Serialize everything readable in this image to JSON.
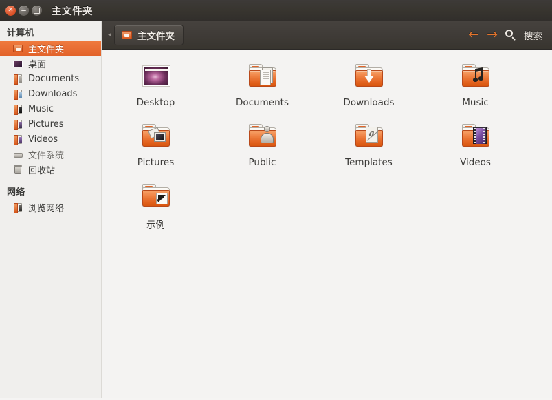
{
  "window": {
    "title": "主文件夹",
    "controls": [
      {
        "name": "close",
        "glyph": "×"
      },
      {
        "name": "minimize",
        "glyph": "−"
      },
      {
        "name": "maximize",
        "glyph": "□"
      }
    ]
  },
  "sidebar": {
    "sections": [
      {
        "header": "计算机",
        "items": [
          {
            "label": "主文件夹",
            "icon": "home-folder-icon",
            "selected": true
          },
          {
            "label": "桌面",
            "icon": "desktop-icon",
            "selected": false
          },
          {
            "label": "Documents",
            "icon": "documents-icon",
            "selected": false
          },
          {
            "label": "Downloads",
            "icon": "downloads-icon",
            "selected": false
          },
          {
            "label": "Music",
            "icon": "music-icon",
            "selected": false
          },
          {
            "label": "Pictures",
            "icon": "pictures-icon",
            "selected": false
          },
          {
            "label": "Videos",
            "icon": "videos-icon",
            "selected": false
          },
          {
            "label": "文件系统",
            "icon": "filesystem-disk-icon",
            "selected": false
          },
          {
            "label": "回收站",
            "icon": "trash-icon",
            "selected": false
          }
        ]
      },
      {
        "header": "网络",
        "items": [
          {
            "label": "浏览网络",
            "icon": "browse-network-icon",
            "selected": false
          }
        ]
      }
    ]
  },
  "toolbar": {
    "breadcrumb": "主文件夹",
    "back_label": "←",
    "forward_label": "→",
    "search_label": "搜索",
    "accent_color": "#e3742c"
  },
  "files": [
    {
      "name": "Desktop",
      "icon": "desktop-wallpaper-icon"
    },
    {
      "name": "Documents",
      "icon": "documents-folder-icon"
    },
    {
      "name": "Downloads",
      "icon": "downloads-folder-icon"
    },
    {
      "name": "Music",
      "icon": "music-folder-icon"
    },
    {
      "name": "Pictures",
      "icon": "pictures-folder-icon"
    },
    {
      "name": "Public",
      "icon": "public-folder-icon"
    },
    {
      "name": "Templates",
      "icon": "templates-folder-icon"
    },
    {
      "name": "Videos",
      "icon": "videos-folder-icon"
    },
    {
      "name": "示例",
      "icon": "examples-symlink-folder-icon"
    }
  ]
}
